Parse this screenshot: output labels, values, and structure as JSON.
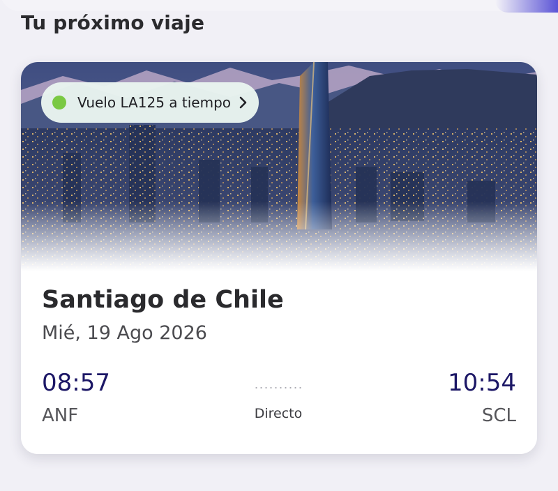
{
  "section": {
    "title": "Tu próximo viaje"
  },
  "card": {
    "status": {
      "text": "Vuelo LA125 a tiempo",
      "dot_color": "#7ac943"
    },
    "destination": "Santiago de Chile",
    "date": "Mié, 19 Ago 2026",
    "departure": {
      "time": "08:57",
      "code": "ANF"
    },
    "arrival": {
      "time": "10:54",
      "code": "SCL"
    },
    "route_type": "Directo"
  },
  "colors": {
    "time_text": "#1c1766",
    "accent": "#5b54d6"
  },
  "icons": {
    "status_chevron": "chevron-right-icon",
    "status_dot": "status-dot-icon"
  }
}
